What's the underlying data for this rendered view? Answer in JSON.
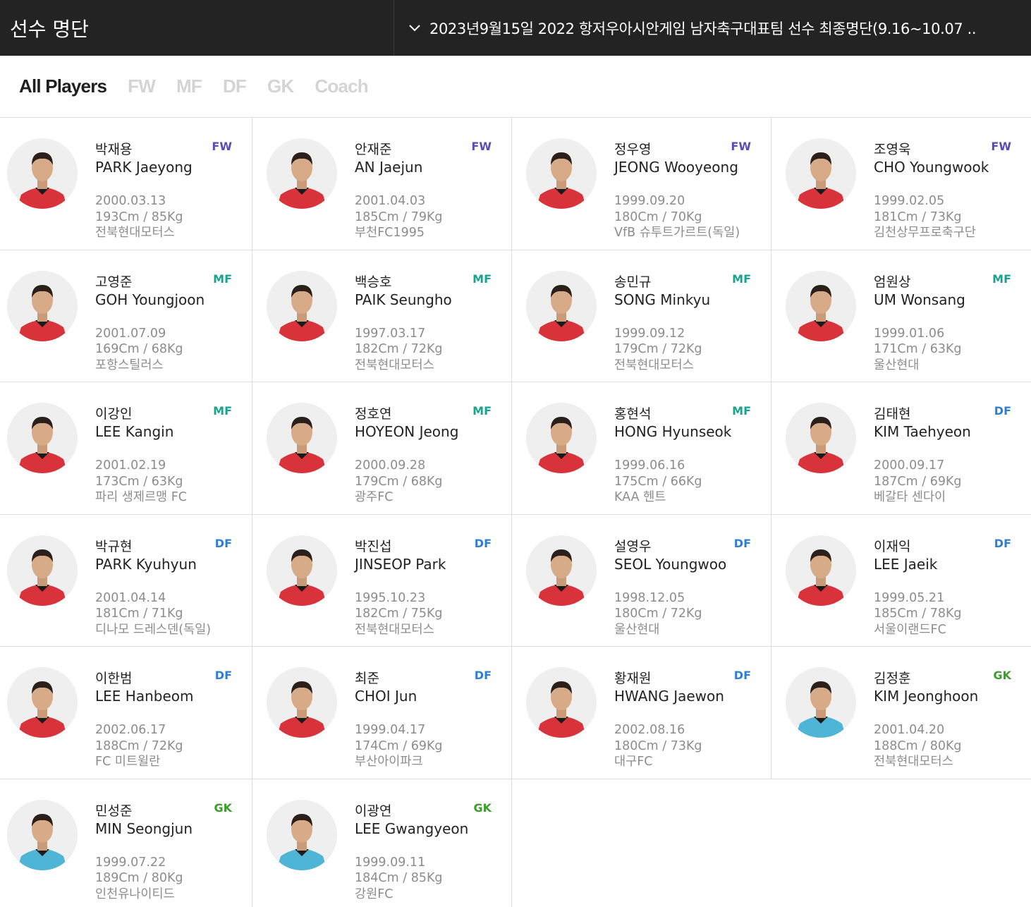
{
  "header": {
    "title": "선수 명단",
    "selector_text": "2023년9월15일 2022 항저우아시안게임 남자축구대표팀 선수 최종명단(9.16~10.07 .."
  },
  "tabs": [
    "All Players",
    "FW",
    "MF",
    "DF",
    "GK",
    "Coach"
  ],
  "active_tab": "All Players",
  "colors": {
    "FW": "#5b4bb7",
    "MF": "#1aa38d",
    "DF": "#2f7fd0",
    "GK": "#3e9c2d",
    "jersey_field": "#d8323b",
    "jersey_gk": "#4fb5d6"
  },
  "players": [
    {
      "kname": "박재용",
      "ename": "PARK Jaeyong",
      "pos": "FW",
      "dob": "2000.03.13",
      "hw": "193Cm / 85Kg",
      "club": "전북현대모터스"
    },
    {
      "kname": "안재준",
      "ename": "AN Jaejun",
      "pos": "FW",
      "dob": "2001.04.03",
      "hw": "185Cm / 79Kg",
      "club": "부천FC1995"
    },
    {
      "kname": "정우영",
      "ename": "JEONG Wooyeong",
      "pos": "FW",
      "dob": "1999.09.20",
      "hw": "180Cm / 70Kg",
      "club": "VfB 슈투트가르트(독일)"
    },
    {
      "kname": "조영욱",
      "ename": "CHO Youngwook",
      "pos": "FW",
      "dob": "1999.02.05",
      "hw": "181Cm / 73Kg",
      "club": "김천상무프로축구단"
    },
    {
      "kname": "고영준",
      "ename": "GOH Youngjoon",
      "pos": "MF",
      "dob": "2001.07.09",
      "hw": "169Cm / 68Kg",
      "club": "포항스틸러스"
    },
    {
      "kname": "백승호",
      "ename": "PAIK Seungho",
      "pos": "MF",
      "dob": "1997.03.17",
      "hw": "182Cm / 72Kg",
      "club": "전북현대모터스"
    },
    {
      "kname": "송민규",
      "ename": "SONG Minkyu",
      "pos": "MF",
      "dob": "1999.09.12",
      "hw": "179Cm / 72Kg",
      "club": "전북현대모터스"
    },
    {
      "kname": "엄원상",
      "ename": "UM Wonsang",
      "pos": "MF",
      "dob": "1999.01.06",
      "hw": "171Cm / 63Kg",
      "club": "울산현대"
    },
    {
      "kname": "이강인",
      "ename": "LEE Kangin",
      "pos": "MF",
      "dob": "2001.02.19",
      "hw": "173Cm / 63Kg",
      "club": "파리 생제르맹 FC"
    },
    {
      "kname": "정호연",
      "ename": "HOYEON Jeong",
      "pos": "MF",
      "dob": "2000.09.28",
      "hw": "179Cm / 68Kg",
      "club": "광주FC"
    },
    {
      "kname": "홍현석",
      "ename": "HONG Hyunseok",
      "pos": "MF",
      "dob": "1999.06.16",
      "hw": "175Cm / 66Kg",
      "club": "KAA 헨트"
    },
    {
      "kname": "김태현",
      "ename": "KIM Taehyeon",
      "pos": "DF",
      "dob": "2000.09.17",
      "hw": "187Cm / 69Kg",
      "club": "베갈타 센다이"
    },
    {
      "kname": "박규현",
      "ename": "PARK Kyuhyun",
      "pos": "DF",
      "dob": "2001.04.14",
      "hw": "181Cm / 71Kg",
      "club": "디나모 드레스덴(독일)"
    },
    {
      "kname": "박진섭",
      "ename": "JINSEOP Park",
      "pos": "DF",
      "dob": "1995.10.23",
      "hw": "182Cm / 75Kg",
      "club": "전북현대모터스"
    },
    {
      "kname": "설영우",
      "ename": "SEOL Youngwoo",
      "pos": "DF",
      "dob": "1998.12.05",
      "hw": "180Cm / 72Kg",
      "club": "울산현대"
    },
    {
      "kname": "이재익",
      "ename": "LEE Jaeik",
      "pos": "DF",
      "dob": "1999.05.21",
      "hw": "185Cm / 78Kg",
      "club": "서울이랜드FC"
    },
    {
      "kname": "이한범",
      "ename": "LEE Hanbeom",
      "pos": "DF",
      "dob": "2002.06.17",
      "hw": "188Cm / 72Kg",
      "club": "FC 미트윌란"
    },
    {
      "kname": "최준",
      "ename": "CHOI Jun",
      "pos": "DF",
      "dob": "1999.04.17",
      "hw": "174Cm / 69Kg",
      "club": "부산아이파크"
    },
    {
      "kname": "황재원",
      "ename": "HWANG Jaewon",
      "pos": "DF",
      "dob": "2002.08.16",
      "hw": "180Cm / 73Kg",
      "club": "대구FC"
    },
    {
      "kname": "김정훈",
      "ename": "KIM Jeonghoon",
      "pos": "GK",
      "dob": "2001.04.20",
      "hw": "188Cm / 80Kg",
      "club": "전북현대모터스"
    },
    {
      "kname": "민성준",
      "ename": "MIN Seongjun",
      "pos": "GK",
      "dob": "1999.07.22",
      "hw": "189Cm / 80Kg",
      "club": "인천유나이티드"
    },
    {
      "kname": "이광연",
      "ename": "LEE Gwangyeon",
      "pos": "GK",
      "dob": "1999.09.11",
      "hw": "184Cm / 85Kg",
      "club": "강원FC"
    }
  ]
}
